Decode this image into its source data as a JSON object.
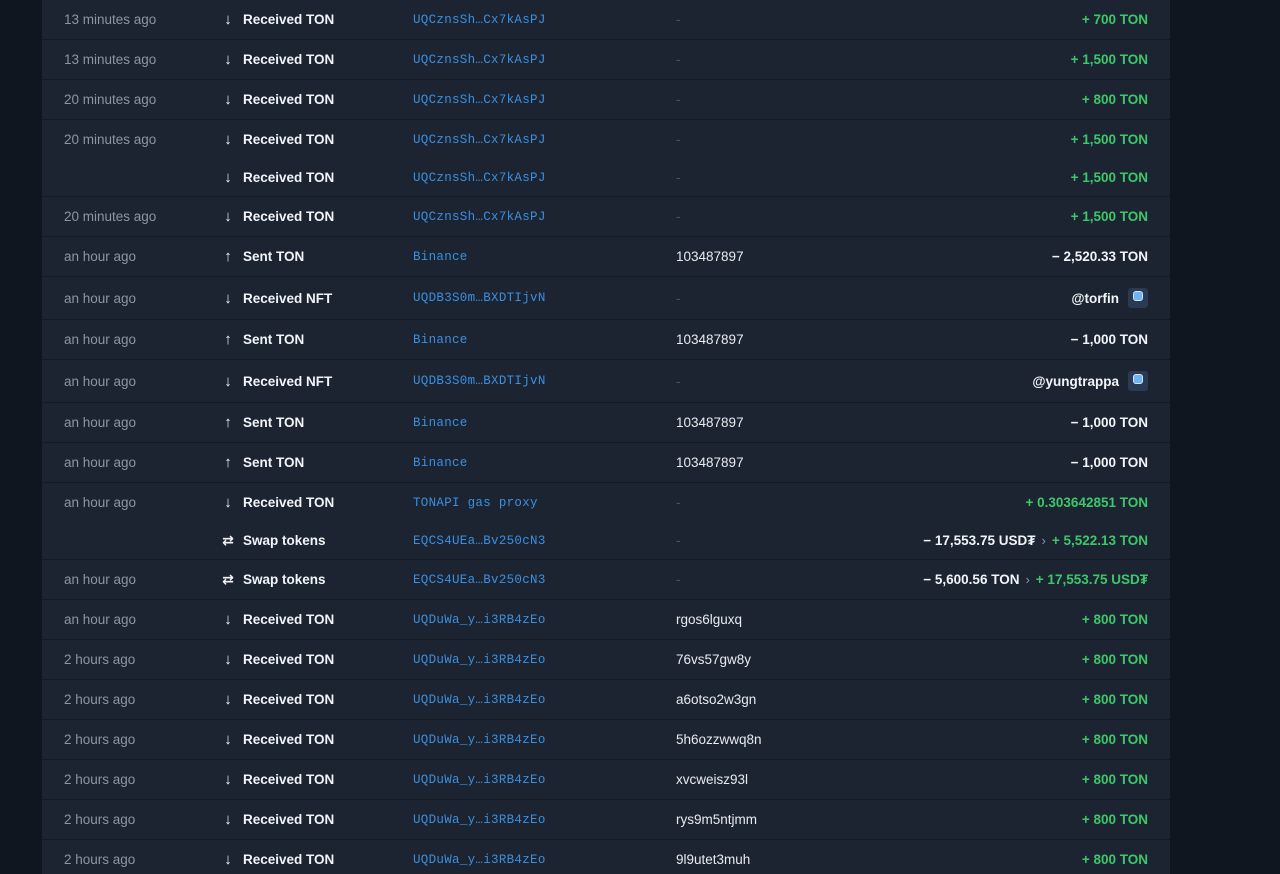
{
  "transactions": [
    {
      "rows": [
        {
          "time": "13 minutes ago",
          "arrow": "↓",
          "action": "Received TON",
          "address": "UQCznsSh…Cx7kAsPJ",
          "comment": "-",
          "amount": "+ 700 TON",
          "dir": "in"
        }
      ]
    },
    {
      "rows": [
        {
          "time": "13 minutes ago",
          "arrow": "↓",
          "action": "Received TON",
          "address": "UQCznsSh…Cx7kAsPJ",
          "comment": "-",
          "amount": "+ 1,500 TON",
          "dir": "in"
        }
      ]
    },
    {
      "rows": [
        {
          "time": "20 minutes ago",
          "arrow": "↓",
          "action": "Received TON",
          "address": "UQCznsSh…Cx7kAsPJ",
          "comment": "-",
          "amount": "+ 800 TON",
          "dir": "in"
        }
      ]
    },
    {
      "rows": [
        {
          "time": "20 minutes ago",
          "arrow": "↓",
          "action": "Received TON",
          "address": "UQCznsSh…Cx7kAsPJ",
          "comment": "-",
          "amount": "+ 1,500 TON",
          "dir": "in"
        },
        {
          "time": "",
          "arrow": "↓",
          "action": "Received TON",
          "address": "UQCznsSh…Cx7kAsPJ",
          "comment": "-",
          "amount": "+ 1,500 TON",
          "dir": "in"
        }
      ]
    },
    {
      "rows": [
        {
          "time": "20 minutes ago",
          "arrow": "↓",
          "action": "Received TON",
          "address": "UQCznsSh…Cx7kAsPJ",
          "comment": "-",
          "amount": "+ 1,500 TON",
          "dir": "in"
        }
      ]
    },
    {
      "rows": [
        {
          "time": "an hour ago",
          "arrow": "↑",
          "action": "Sent TON",
          "address": "Binance",
          "comment": "103487897",
          "amount": "− 2,520.33 TON",
          "dir": "out"
        }
      ]
    },
    {
      "tall": true,
      "rows": [
        {
          "time": "an hour ago",
          "arrow": "↓",
          "action": "Received NFT",
          "address": "UQDB3S0m…BXDTIjvN",
          "comment": "-",
          "nft": "@torfin",
          "dir": "nft"
        }
      ]
    },
    {
      "rows": [
        {
          "time": "an hour ago",
          "arrow": "↑",
          "action": "Sent TON",
          "address": "Binance",
          "comment": "103487897",
          "amount": "− 1,000 TON",
          "dir": "out"
        }
      ]
    },
    {
      "tall": true,
      "rows": [
        {
          "time": "an hour ago",
          "arrow": "↓",
          "action": "Received NFT",
          "address": "UQDB3S0m…BXDTIjvN",
          "comment": "-",
          "nft": "@yungtrappa",
          "dir": "nft"
        }
      ]
    },
    {
      "rows": [
        {
          "time": "an hour ago",
          "arrow": "↑",
          "action": "Sent TON",
          "address": "Binance",
          "comment": "103487897",
          "amount": "− 1,000 TON",
          "dir": "out"
        }
      ]
    },
    {
      "rows": [
        {
          "time": "an hour ago",
          "arrow": "↑",
          "action": "Sent TON",
          "address": "Binance",
          "comment": "103487897",
          "amount": "− 1,000 TON",
          "dir": "out"
        }
      ]
    },
    {
      "rows": [
        {
          "time": "an hour ago",
          "arrow": "↓",
          "action": "Received TON",
          "address": "TONAPI gas proxy",
          "comment": "-",
          "amount": "+ 0.303642851 TON",
          "dir": "in"
        },
        {
          "time": "",
          "arrow": "⇄",
          "action": "Swap tokens",
          "address": "EQCS4UEa…Bv250cN3",
          "comment": "-",
          "swap_out": "− 17,553.75 USD₮",
          "swap_in": "+ 5,522.13 TON",
          "dir": "swap"
        }
      ]
    },
    {
      "rows": [
        {
          "time": "an hour ago",
          "arrow": "⇄",
          "action": "Swap tokens",
          "address": "EQCS4UEa…Bv250cN3",
          "comment": "-",
          "swap_out": "− 5,600.56 TON",
          "swap_in": "+ 17,553.75 USD₮",
          "dir": "swap"
        }
      ]
    },
    {
      "rows": [
        {
          "time": "an hour ago",
          "arrow": "↓",
          "action": "Received TON",
          "address": "UQDuWa_y…i3RB4zEo",
          "comment": "rgos6lguxq",
          "amount": "+ 800 TON",
          "dir": "in"
        }
      ]
    },
    {
      "rows": [
        {
          "time": "2 hours ago",
          "arrow": "↓",
          "action": "Received TON",
          "address": "UQDuWa_y…i3RB4zEo",
          "comment": "76vs57gw8y",
          "amount": "+ 800 TON",
          "dir": "in"
        }
      ]
    },
    {
      "rows": [
        {
          "time": "2 hours ago",
          "arrow": "↓",
          "action": "Received TON",
          "address": "UQDuWa_y…i3RB4zEo",
          "comment": "a6otso2w3gn",
          "amount": "+ 800 TON",
          "dir": "in"
        }
      ]
    },
    {
      "rows": [
        {
          "time": "2 hours ago",
          "arrow": "↓",
          "action": "Received TON",
          "address": "UQDuWa_y…i3RB4zEo",
          "comment": "5h6ozzwwq8n",
          "amount": "+ 800 TON",
          "dir": "in"
        }
      ]
    },
    {
      "rows": [
        {
          "time": "2 hours ago",
          "arrow": "↓",
          "action": "Received TON",
          "address": "UQDuWa_y…i3RB4zEo",
          "comment": "xvcweisz93l",
          "amount": "+ 800 TON",
          "dir": "in"
        }
      ]
    },
    {
      "rows": [
        {
          "time": "2 hours ago",
          "arrow": "↓",
          "action": "Received TON",
          "address": "UQDuWa_y…i3RB4zEo",
          "comment": "rys9m5ntjmm",
          "amount": "+ 800 TON",
          "dir": "in"
        }
      ]
    },
    {
      "rows": [
        {
          "time": "2 hours ago",
          "arrow": "↓",
          "action": "Received TON",
          "address": "UQDuWa_y…i3RB4zEo",
          "comment": "9l9utet3muh",
          "amount": "+ 800 TON",
          "dir": "in"
        }
      ]
    }
  ],
  "swap_separator": "›",
  "colors": {
    "background": "#10161f",
    "panel": "#1c2431",
    "positive": "#3bc86b",
    "link": "#3b8fe0",
    "muted": "#8b95a3"
  }
}
